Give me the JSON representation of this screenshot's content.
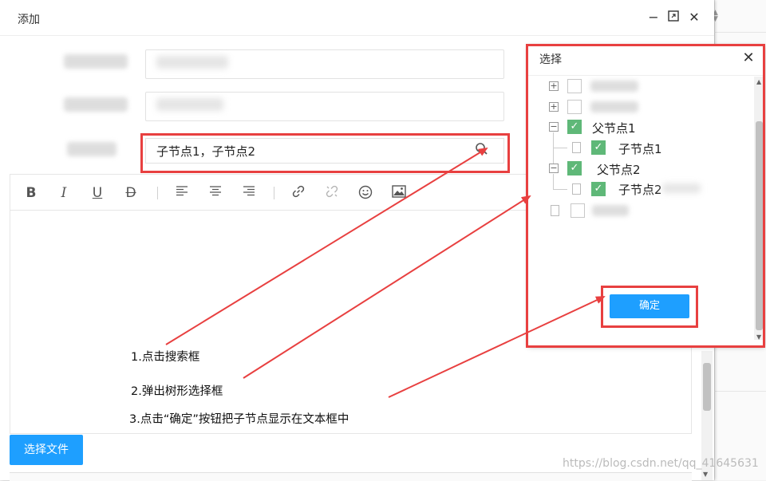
{
  "dialog": {
    "title": "添加"
  },
  "field_search": {
    "value": "子节点1，子节点2"
  },
  "toolbar": {
    "icons": [
      "bold-icon",
      "italic-icon",
      "underline-icon",
      "strikethrough-icon",
      "align-left-icon",
      "align-center-icon",
      "align-right-icon",
      "link-icon",
      "unlink-icon",
      "emoji-icon",
      "image-icon"
    ]
  },
  "annotations": {
    "step1": "1.点击搜索框",
    "step2": "2.弹出树形选择框",
    "step3": "3.点击“确定”按钮把子节点显示在文本框中"
  },
  "buttons": {
    "select_file": "选择文件",
    "confirm": "确定"
  },
  "tree_popup": {
    "title": "选择",
    "nodes": [
      {
        "label": "父节点1",
        "checked": true
      },
      {
        "label": "子节点1",
        "checked": true
      },
      {
        "label": "父节点2",
        "checked": true
      },
      {
        "label": "子节点2",
        "checked": true
      }
    ]
  },
  "watermark": "https://blog.csdn.net/qq_41645631",
  "colors": {
    "accent": "#1e9fff",
    "checked": "#5fb878",
    "annotation": "#e84040"
  }
}
